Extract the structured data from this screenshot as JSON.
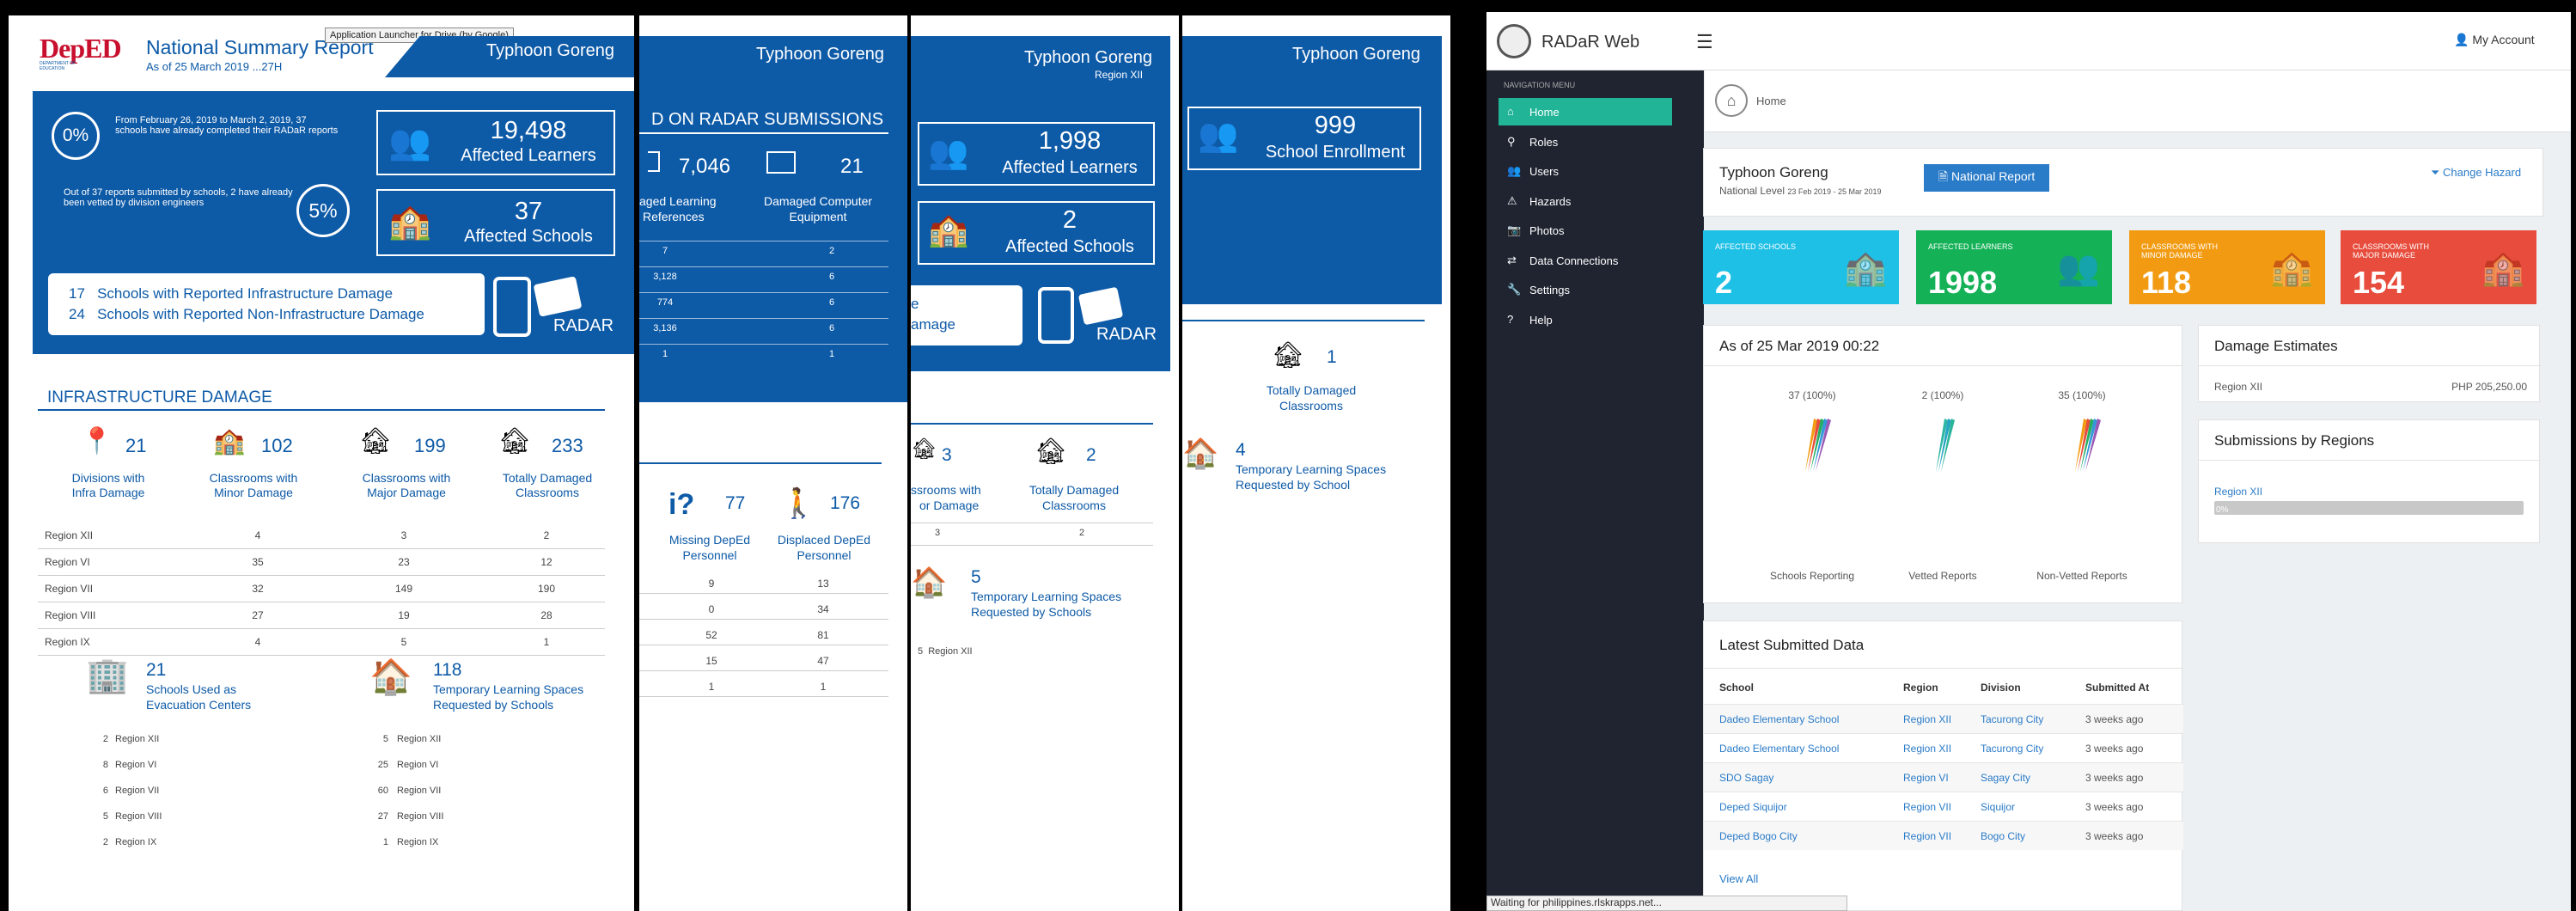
{
  "panel1": {
    "logo": "DepED",
    "logo_sub": "DEPARTMENT OF EDUCATION",
    "title": "National Summary Report",
    "asof": "As of 25 March 2019 ...27H",
    "tooltip": "Application Launcher for Drive (by Google)",
    "hazard": "Typhoon Goreng",
    "pct0": "0%",
    "pct0_text": "From February 26, 2019 to March 2, 2019, 37 schools have already completed their RADaR reports",
    "pct5": "5%",
    "pct5_text": "Out of 37 reports submitted by schools, 2 have already been vetted by division engineers",
    "learners_num": "19,498",
    "learners_lbl": "Affected Learners",
    "schools_num": "37",
    "schools_lbl": "Affected Schools",
    "infra_line": "17   Schools with Reported Infrastructure Damage",
    "noninfra_line": "24   Schools with Reported Non-Infrastructure Damage",
    "radar": "RADAR",
    "section": "INFRASTRUCTURE DAMAGE",
    "stats": [
      {
        "num": "21",
        "lbl": "Divisions with Infra Damage"
      },
      {
        "num": "102",
        "lbl": "Classrooms with Minor Damage"
      },
      {
        "num": "199",
        "lbl": "Classrooms with Major Damage"
      },
      {
        "num": "233",
        "lbl": "Totally Damaged Classrooms"
      }
    ],
    "rows": [
      {
        "region": "Region XII",
        "a": "4",
        "b": "3",
        "c": "2"
      },
      {
        "region": "Region VI",
        "a": "35",
        "b": "23",
        "c": "12"
      },
      {
        "region": "Region VII",
        "a": "32",
        "b": "149",
        "c": "190"
      },
      {
        "region": "Region VIII",
        "a": "27",
        "b": "19",
        "c": "28"
      },
      {
        "region": "Region IX",
        "a": "4",
        "b": "5",
        "c": "1"
      }
    ],
    "evac_num": "21",
    "evac_lbl1": "Schools Used as",
    "evac_lbl2": "Evacuation Centers",
    "tls_num": "118",
    "tls_lbl1": "Temporary Learning Spaces",
    "tls_lbl2": "Requested by Schools",
    "evac_rows": [
      {
        "n": "2",
        "r": "Region XII"
      },
      {
        "n": "8",
        "r": "Region VI"
      },
      {
        "n": "6",
        "r": "Region VII"
      },
      {
        "n": "5",
        "r": "Region VIII"
      },
      {
        "n": "2",
        "r": "Region IX"
      }
    ],
    "tls_rows": [
      {
        "n": "5",
        "r": "Region XII"
      },
      {
        "n": "25",
        "r": "Region VI"
      },
      {
        "n": "60",
        "r": "Region VII"
      },
      {
        "n": "27",
        "r": "Region VIII"
      },
      {
        "n": "1",
        "r": "Region IX"
      }
    ]
  },
  "panel2": {
    "hazard": "Typhoon Goreng",
    "heading": "D ON RADAR SUBMISSIONS",
    "s1_num": "7,046",
    "s1_lbl1": "aged Learning",
    "s1_lbl2": "References",
    "s2_num": "21",
    "s2_lbl1": "Damaged Computer",
    "s2_lbl2": "Equipment",
    "rows": [
      {
        "a": "7",
        "b": "2"
      },
      {
        "a": "3,128",
        "b": "6"
      },
      {
        "a": "774",
        "b": "6"
      },
      {
        "a": "3,136",
        "b": "6"
      },
      {
        "a": "1",
        "b": "1"
      }
    ],
    "missing_num": "77",
    "missing_lbl1": "Missing DepEd",
    "missing_lbl2": "Personnel",
    "displaced_num": "176",
    "displaced_lbl1": "Displaced DepEd",
    "displaced_lbl2": "Personnel",
    "rows2": [
      {
        "a": "9",
        "b": "13"
      },
      {
        "a": "0",
        "b": "34"
      },
      {
        "a": "52",
        "b": "81"
      },
      {
        "a": "15",
        "b": "47"
      },
      {
        "a": "1",
        "b": "1"
      }
    ]
  },
  "panel3": {
    "hazard": "Typhoon Goreng",
    "region": "Region XII",
    "learners_num": "1,998",
    "learners_lbl": "Affected Learners",
    "schools_num": "2",
    "schools_lbl": "Affected Schools",
    "frag1": "e",
    "frag2": "amage",
    "radar": "RADAR",
    "s1_num": "3",
    "s1_lbl1": "ssrooms with",
    "s1_lbl2": "or Damage",
    "s2_num": "2",
    "s2_lbl1": "Totally Damaged",
    "s2_lbl2": "Classrooms",
    "row_a": "3",
    "row_b": "2",
    "tls_num": "5",
    "tls_lbl1": "Temporary Learning Spaces",
    "tls_lbl2": "Requested by Schools",
    "tls_row": "5  Region XII"
  },
  "panel4": {
    "hazard": "Typhoon Goreng",
    "enroll_num": "999",
    "enroll_lbl": "School Enrollment",
    "s1_num": "1",
    "s1_lbl1": "Totally Damaged",
    "s1_lbl2": "Classrooms",
    "tls_num": "4",
    "tls_lbl1": "Temporary Learning Spaces",
    "tls_lbl2": "Requested by School"
  },
  "web": {
    "brand": "RADaR Web",
    "account": "My Account",
    "nav_header": "NAVIGATION MENU",
    "nav": [
      "Home",
      "Roles",
      "Users",
      "Hazards",
      "Photos",
      "Data Connections",
      "Settings",
      "Help"
    ],
    "breadcrumb": "Home",
    "hazard_title": "Typhoon Goreng",
    "hazard_level": "National Level",
    "hazard_dates": "23 Feb 2019 - 25 Mar 2019",
    "national_report": "National Report",
    "change_hazard": "Change Hazard",
    "tiles": [
      {
        "label": "AFFECTED SCHOOLS",
        "value": "2",
        "color": "#1fc0e6"
      },
      {
        "label": "AFFECTED LEARNERS",
        "value": "1998",
        "color": "#14b157"
      },
      {
        "label": "CLASSROOMS WITH MINOR DAMAGE",
        "value": "118",
        "color": "#f29b12"
      },
      {
        "label": "CLASSROOMS WITH MAJOR DAMAGE",
        "value": "154",
        "color": "#e74c3c"
      }
    ],
    "asof": "As of 25 Mar 2019 00:22",
    "gauges": [
      {
        "top": "37 (100%)",
        "label": "Schools Reporting"
      },
      {
        "top": "2 (100%)",
        "label": "Vetted Reports"
      },
      {
        "top": "35 (100%)",
        "label": "Non-Vetted Reports"
      }
    ],
    "damage_title": "Damage Estimates",
    "damage_region": "Region XII",
    "damage_value": "PHP 205,250.00",
    "subm_title": "Submissions by Regions",
    "subm_region": "Region XII",
    "subm_pct": "0%",
    "latest_title": "Latest Submitted Data",
    "latest_cols": [
      "School",
      "Region",
      "Division",
      "Submitted At"
    ],
    "latest_rows": [
      [
        "Dadeo Elementary School",
        "Region XII",
        "Tacurong City",
        "3 weeks ago"
      ],
      [
        "Dadeo Elementary School",
        "Region XII",
        "Tacurong City",
        "3 weeks ago"
      ],
      [
        "SDO Sagay",
        "Region VI",
        "Sagay City",
        "3 weeks ago"
      ],
      [
        "Deped Siquijor",
        "Region VII",
        "Siquijor",
        "3 weeks ago"
      ],
      [
        "Deped Bogo City",
        "Region VII",
        "Bogo City",
        "3 weeks ago"
      ]
    ],
    "view_all": "View All",
    "status": "Waiting for philippines.rlskrapps.net..."
  }
}
